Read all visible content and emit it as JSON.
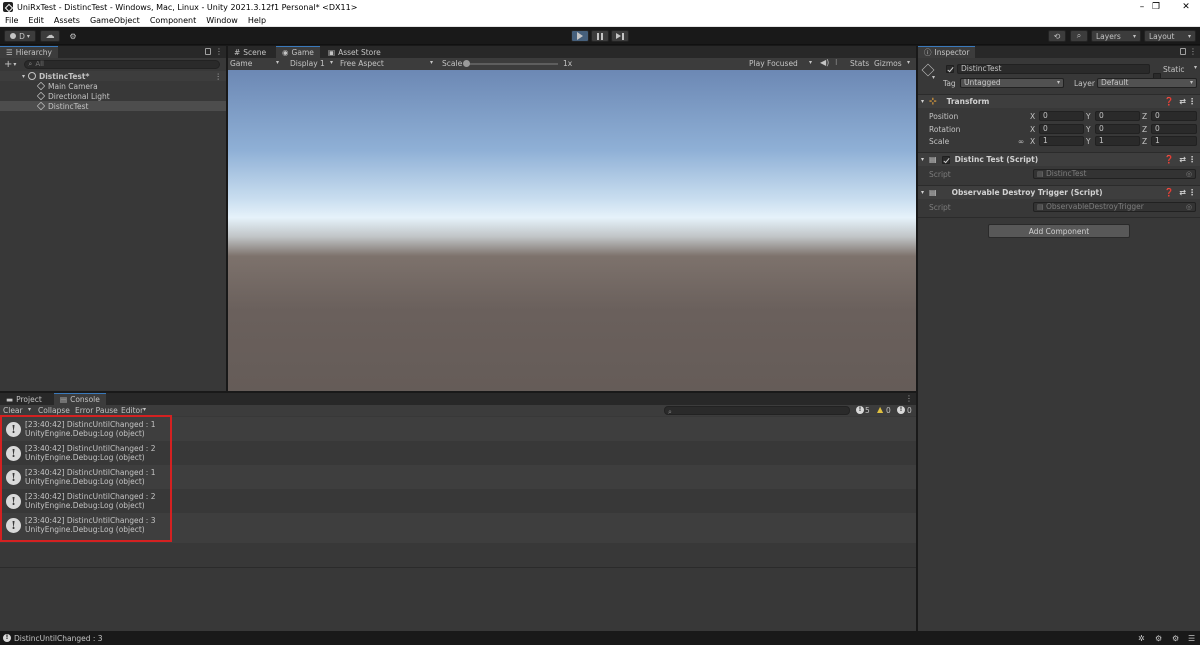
{
  "window": {
    "title": "UniRxTest - DistincTest - Windows, Mac, Linux - Unity 2021.3.12f1 Personal* <DX11>",
    "controls": [
      "–",
      "❐",
      "✕"
    ]
  },
  "menu": [
    "File",
    "Edit",
    "Assets",
    "GameObject",
    "Component",
    "Window",
    "Help"
  ],
  "toolbar": {
    "account": "D",
    "layers": "Layers",
    "layout": "Layout"
  },
  "hierarchy": {
    "tab": "Hierarchy",
    "search_placeholder": "All",
    "scene": "DistincTest*",
    "items": [
      "Main Camera",
      "Directional Light",
      "DistincTest"
    ]
  },
  "gameview": {
    "tabs": [
      "Scene",
      "Game",
      "Asset Store"
    ],
    "game_dropdown": "Game",
    "display": "Display 1",
    "aspect": "Free Aspect",
    "scale_label": "Scale",
    "scale_value": "1x",
    "play_focused": "Play Focused",
    "stats": "Stats",
    "gizmos": "Gizmos"
  },
  "inspector": {
    "tab": "Inspector",
    "object_name": "DistincTest",
    "static_label": "Static",
    "tag_label": "Tag",
    "tag_value": "Untagged",
    "layer_label": "Layer",
    "layer_value": "Default",
    "transform": {
      "title": "Transform",
      "rows": [
        {
          "label": "Position",
          "x": "0",
          "y": "0",
          "z": "0"
        },
        {
          "label": "Rotation",
          "x": "0",
          "y": "0",
          "z": "0"
        },
        {
          "label": "Scale",
          "x": "1",
          "y": "1",
          "z": "1"
        }
      ],
      "axis": [
        "X",
        "Y",
        "Z"
      ]
    },
    "components": [
      {
        "title": "Distinc Test (Script)",
        "script_label": "Script",
        "script_value": "DistincTest"
      },
      {
        "title": "Observable Destroy Trigger (Script)",
        "script_label": "Script",
        "script_value": "ObservableDestroyTrigger"
      }
    ],
    "add_component": "Add Component"
  },
  "console": {
    "tabs": [
      "Project",
      "Console"
    ],
    "toolbar": [
      "Clear",
      "Collapse",
      "Error Pause",
      "Editor"
    ],
    "counts": {
      "info": "5",
      "warning": "0",
      "error": "0"
    },
    "entries": [
      {
        "line1": "[23:40:42] DistincUntilChanged : 1",
        "line2": "UnityEngine.Debug:Log (object)"
      },
      {
        "line1": "[23:40:42] DistincUntilChanged : 2",
        "line2": "UnityEngine.Debug:Log (object)"
      },
      {
        "line1": "[23:40:42] DistincUntilChanged : 1",
        "line2": "UnityEngine.Debug:Log (object)"
      },
      {
        "line1": "[23:40:42] DistincUntilChanged : 2",
        "line2": "UnityEngine.Debug:Log (object)"
      },
      {
        "line1": "[23:40:42] DistincUntilChanged : 3",
        "line2": "UnityEngine.Debug:Log (object)"
      }
    ]
  },
  "statusbar": {
    "message": "DistincUntilChanged : 3"
  },
  "colors": {
    "highlight_box": "#d42121",
    "active_tab_accent": "#3a79bb"
  }
}
